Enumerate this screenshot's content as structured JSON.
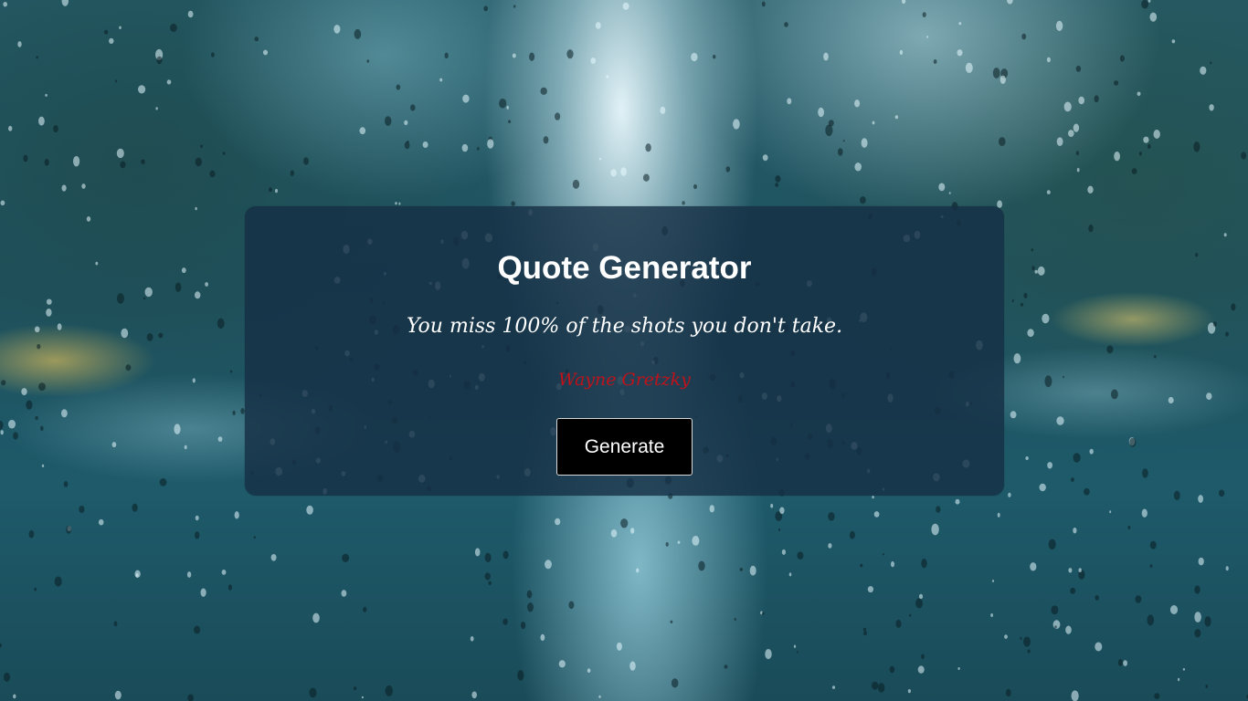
{
  "card": {
    "title": "Quote Generator",
    "quote": "You miss 100% of the shots you don't take.",
    "author": "Wayne Gretzky",
    "generate_label": "Generate"
  },
  "colors": {
    "card_background": "#16304a",
    "author_text": "#c0121a",
    "button_background": "#000000",
    "text": "#ffffff"
  }
}
